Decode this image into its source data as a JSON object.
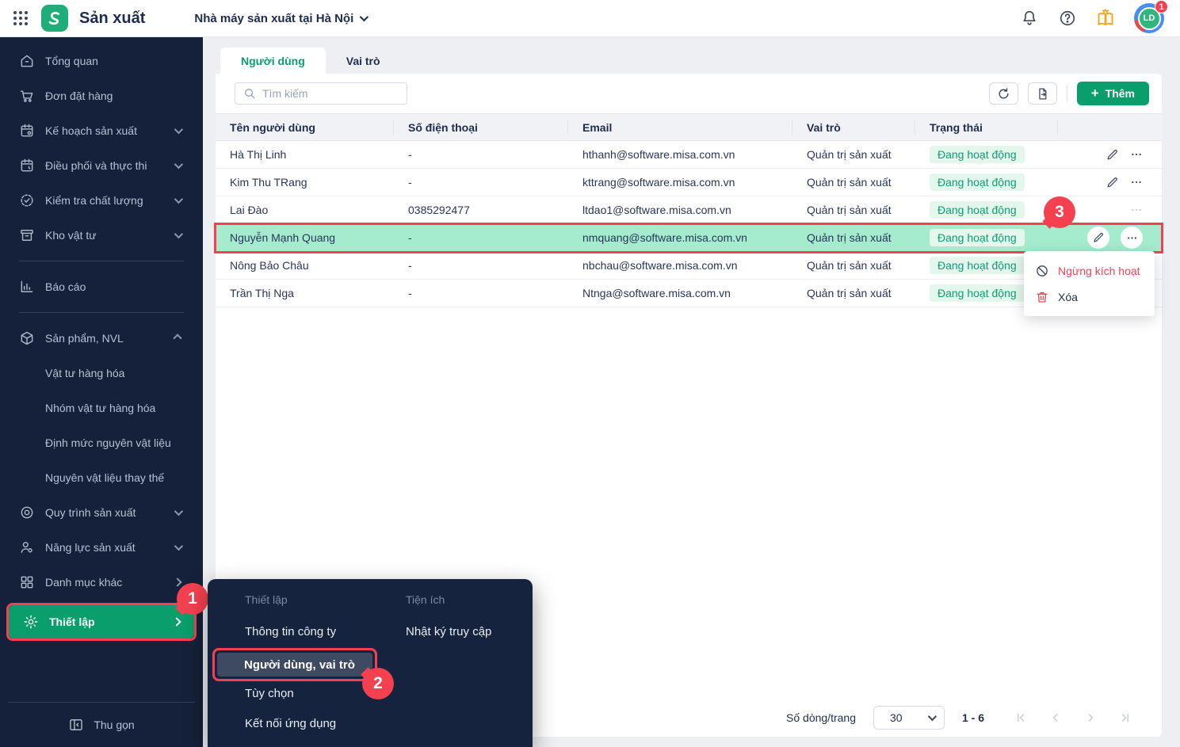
{
  "header": {
    "app_title": "Sản xuất",
    "workspace_selector": "Nhà máy sản xuất tại Hà Nội",
    "avatar_initials": "LD",
    "notification_badge": "1"
  },
  "sidebar": {
    "main_items": [
      "Tổng quan",
      "Đơn đặt hàng",
      "Kế hoạch sản xuất",
      "Điều phối và thực thi",
      "Kiểm tra chất lượng",
      "Kho vật tư"
    ],
    "report_label": "Báo cáo",
    "products_label": "Sản phẩm, NVL",
    "product_children": [
      "Vật tư hàng hóa",
      "Nhóm vật tư hàng hóa",
      "Định mức nguyên vật liệu",
      "Nguyên vật liệu thay thế"
    ],
    "process_label": "Quy trình sản xuất",
    "capacity_label": "Năng lực sản xuất",
    "other_label": "Danh mục khác",
    "settings_label": "Thiết lập",
    "collapse_label": "Thu gọn"
  },
  "tabs": {
    "users": "Người dùng",
    "roles": "Vai trò"
  },
  "toolbar": {
    "search_placeholder": "Tìm kiếm",
    "add_label": "Thêm",
    "add_plus": "+"
  },
  "table": {
    "columns": [
      "Tên người dùng",
      "Số điện thoại",
      "Email",
      "Vai trò",
      "Trạng thái"
    ],
    "rows": [
      {
        "name": "Hà Thị Linh",
        "phone": "-",
        "email": "hthanh@software.misa.com.vn",
        "role": "Quản trị sản xuất",
        "status": "Đang hoạt động"
      },
      {
        "name": "Kim Thu TRang",
        "phone": "-",
        "email": "kttrang@software.misa.com.vn",
        "role": "Quản trị sản xuất",
        "status": "Đang hoạt động"
      },
      {
        "name": "Lai Đào",
        "phone": "0385292477",
        "email": "ltdao1@software.misa.com.vn",
        "role": "Quản trị sản xuất",
        "status": "Đang hoạt động"
      },
      {
        "name": "Nguyễn Mạnh Quang",
        "phone": "-",
        "email": "nmquang@software.misa.com.vn",
        "role": "Quản trị sản xuất",
        "status": "Đang hoạt động"
      },
      {
        "name": "Nông Bảo Châu",
        "phone": "-",
        "email": "nbchau@software.misa.com.vn",
        "role": "Quản trị sản xuất",
        "status": "Đang hoạt động"
      },
      {
        "name": "Trần Thị Nga",
        "phone": "-",
        "email": "Ntnga@software.misa.com.vn",
        "role": "Quản trị sản xuất",
        "status": "Đang hoạt động"
      }
    ]
  },
  "row_menu": {
    "deactivate": "Ngừng kích hoạt",
    "delete": "Xóa"
  },
  "settings_popup": {
    "section1_title": "Thiết lập",
    "section1_items": [
      "Thông tin công ty",
      "Người dùng, vai trò",
      "Tùy chọn",
      "Kết nối ứng dụng"
    ],
    "section2_title": "Tiện ích",
    "section2_items": [
      "Nhật ký truy cập"
    ]
  },
  "pagination": {
    "rows_per_page_label": "Số dòng/trang",
    "page_size": "30",
    "range": "1 - 6"
  },
  "annotations": {
    "step1": "1",
    "step2": "2",
    "step3": "3"
  },
  "colors": {
    "brand_green": "#0a9e6c",
    "sidebar_bg": "#15213a",
    "annotation_red": "#f5414f",
    "status_green": "#0f9d75",
    "highlight_row": "#a5ecce"
  }
}
